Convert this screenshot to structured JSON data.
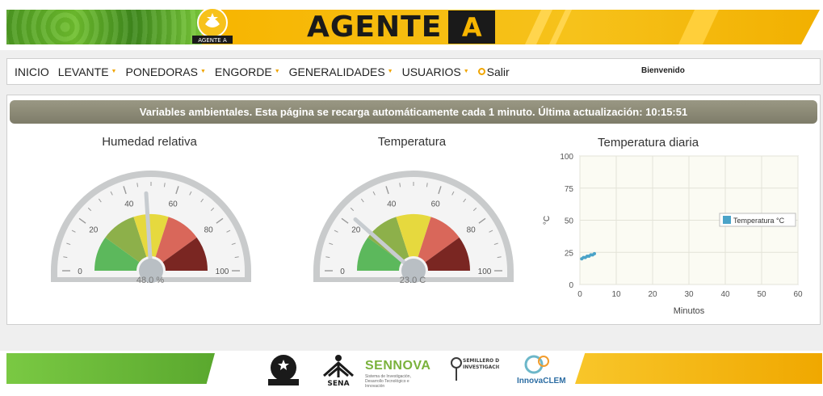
{
  "header": {
    "title": "AGENTE",
    "title_letter": "A",
    "badge_label": "AGENTE A",
    "colors": {
      "green": "#5aa82e",
      "yellow": "#f7b500",
      "dark": "#1a1a1a"
    }
  },
  "nav": {
    "items": [
      {
        "label": "INICIO",
        "has_dropdown": false
      },
      {
        "label": "LEVANTE",
        "has_dropdown": true
      },
      {
        "label": "PONEDORAS",
        "has_dropdown": true
      },
      {
        "label": "ENGORDE",
        "has_dropdown": true
      },
      {
        "label": "GENERALIDADES",
        "has_dropdown": true
      },
      {
        "label": "USUARIOS",
        "has_dropdown": true
      }
    ],
    "logout_label": "Salir",
    "welcome": "Bienvenido"
  },
  "panel": {
    "header": "Variables ambientales. Esta página se recarga automáticamente cada 1 minuto. Última actualización: 10:15:51"
  },
  "gauges": {
    "humidity": {
      "title": "Humedad relativa",
      "value": 48.0,
      "value_text": "48.0 %",
      "min": 0,
      "max": 100,
      "major_ticks": [
        "0",
        "20",
        "40",
        "60",
        "80",
        "100"
      ]
    },
    "temperature": {
      "title": "Temperatura",
      "value": 23.0,
      "value_text": "23.0 C",
      "min": 0,
      "max": 100,
      "major_ticks": [
        "0",
        "20",
        "40",
        "60",
        "80",
        "100"
      ]
    },
    "band_colors": [
      "#5cb85c",
      "#8db04a",
      "#e6d93e",
      "#d9675a",
      "#7a2622"
    ]
  },
  "chart_data": {
    "type": "line",
    "title": "Temperatura diaria",
    "xlabel": "Minutos",
    "ylabel": "°C",
    "xlim": [
      0,
      60
    ],
    "ylim": [
      0,
      100
    ],
    "x_ticks": [
      "0",
      "10",
      "20",
      "30",
      "40",
      "50",
      "60"
    ],
    "y_ticks": [
      "0",
      "25",
      "50",
      "75",
      "100"
    ],
    "grid": true,
    "legend_position": "right",
    "series": [
      {
        "name": "Temperatura °C",
        "color": "#4aa3c8",
        "x": [
          0.5,
          1,
          1.5,
          2,
          2.5,
          3,
          3.5,
          4
        ],
        "y": [
          20,
          21,
          21,
          22,
          22,
          23,
          23,
          24
        ]
      }
    ]
  },
  "footer": {
    "logos": [
      "agente-a-logo",
      "sena-logo",
      "sennova-logo",
      "semillero-logo",
      "innovaclem-logo"
    ],
    "sennova_label": "SENNOVA",
    "sennova_sub": "Sistema de Investigación, Desarrollo Tecnológico e Innovación",
    "innova_label": "InnovaCLEM",
    "sena_label": "SENA",
    "semillero_label": "SEMILLERO DE INVESTIGACIÓN"
  }
}
